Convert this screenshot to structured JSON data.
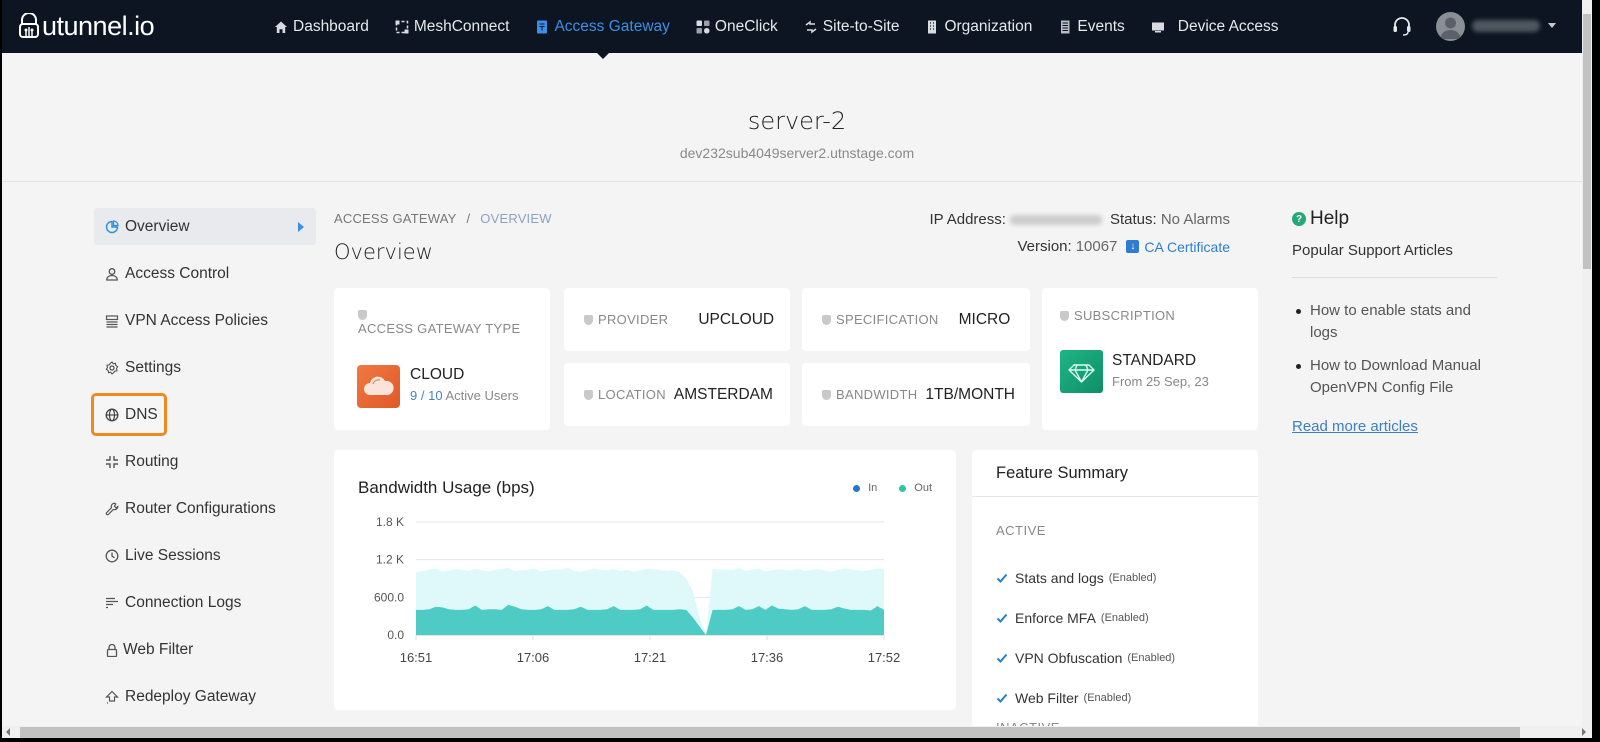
{
  "topnav": {
    "logo": "utunnel.io",
    "items": [
      {
        "label": "Dashboard",
        "icon": "home-icon"
      },
      {
        "label": "MeshConnect",
        "icon": "mesh-icon"
      },
      {
        "label": "Access Gateway",
        "icon": "gateway-icon",
        "active": true
      },
      {
        "label": "OneClick",
        "icon": "apps-icon"
      },
      {
        "label": "Site-to-Site",
        "icon": "arrows-icon"
      },
      {
        "label": "Organization",
        "icon": "building-icon"
      },
      {
        "label": "Events",
        "icon": "events-icon"
      },
      {
        "label": "Device Access",
        "icon": "monitor-icon"
      }
    ]
  },
  "server": {
    "name": "server-2",
    "host": "dev232sub4049server2.utnstage.com"
  },
  "sidebar": {
    "items": [
      {
        "label": "Overview",
        "icon": "pie-icon",
        "active": true
      },
      {
        "label": "Access Control",
        "icon": "user-icon"
      },
      {
        "label": "VPN Access Policies",
        "icon": "list-icon"
      },
      {
        "label": "Settings",
        "icon": "gear-icon"
      },
      {
        "label": "DNS",
        "icon": "globe-icon",
        "highlighted": true
      },
      {
        "label": "Routing",
        "icon": "routing-icon"
      },
      {
        "label": "Router Configurations",
        "icon": "wrench-icon"
      },
      {
        "label": "Live Sessions",
        "icon": "clock-icon"
      },
      {
        "label": "Connection Logs",
        "icon": "lines-icon"
      },
      {
        "label": "Web Filter",
        "icon": "lock-icon"
      },
      {
        "label": "Redeploy Gateway",
        "icon": "redeploy-icon"
      }
    ]
  },
  "breadcrumb": {
    "parent": "ACCESS GATEWAY",
    "sep": "/",
    "current": "OVERVIEW"
  },
  "page_title": "Overview",
  "meta": {
    "ip_label": "IP Address:",
    "status_label": "Status:",
    "status_value": "No Alarms",
    "version_label": "Version:",
    "version_value": "10067",
    "ca_label": "CA Certificate"
  },
  "cards": {
    "type": {
      "label": "ACCESS GATEWAY TYPE",
      "value": "CLOUD",
      "active_users": "9",
      "sep": "/",
      "total_users": "10",
      "users_suffix": "Active Users"
    },
    "provider": {
      "label": "PROVIDER",
      "value": "UPCLOUD"
    },
    "location": {
      "label": "LOCATION",
      "value": "AMSTERDAM"
    },
    "specification": {
      "label": "SPECIFICATION",
      "value": "MICRO"
    },
    "bandwidth": {
      "label": "BANDWIDTH",
      "value": "1TB/MONTH"
    },
    "subscription": {
      "label": "SUBSCRIPTION",
      "value": "STANDARD",
      "since": "From 25 Sep, 23"
    }
  },
  "chart_data": {
    "type": "area",
    "title": "Bandwidth Usage (bps)",
    "xlabel": "",
    "ylabel": "",
    "ylim": [
      0,
      1800
    ],
    "yticks": [
      "0.0",
      "600.0",
      "1.2 K",
      "1.8 K"
    ],
    "ytick_values": [
      0,
      600,
      1200,
      1800
    ],
    "xticks": [
      "16:51",
      "17:06",
      "17:21",
      "17:36",
      "17:52"
    ],
    "legend_position": "top-right",
    "grid": true,
    "colors": {
      "In": "#1f7bc4",
      "Out": "#2ec6a0",
      "in_fill": "#dff9fb",
      "out_fill": "#4ecbc4"
    },
    "series": [
      {
        "name": "In",
        "values": [
          1000,
          1020,
          1040,
          1060,
          1010,
          1030,
          1050,
          1040,
          1020,
          1060,
          1030,
          1010,
          1040,
          1050,
          1070,
          1020,
          1030,
          1040,
          1060,
          1010,
          1030,
          1050,
          1040,
          1070,
          1020,
          1010,
          1030,
          1060,
          1040,
          1030,
          1050,
          1020,
          1040,
          1010,
          1030,
          1060,
          1050,
          1040,
          1020,
          1030,
          1000,
          900,
          700,
          300,
          0,
          1060,
          1040,
          1050,
          1030,
          1070,
          1020,
          1040,
          1060,
          1010,
          1030,
          1050,
          1040,
          1030,
          1060,
          1020,
          1040,
          1050,
          1030,
          1010,
          1040,
          1060,
          1050,
          1030,
          1020,
          1040,
          1060,
          1050
        ]
      },
      {
        "name": "Out",
        "values": [
          400,
          400,
          410,
          450,
          440,
          410,
          400,
          400,
          410,
          470,
          400,
          410,
          410,
          400,
          480,
          450,
          410,
          400,
          400,
          410,
          460,
          400,
          400,
          400,
          410,
          450,
          400,
          400,
          400,
          410,
          460,
          400,
          400,
          400,
          410,
          470,
          400,
          400,
          400,
          400,
          410,
          400,
          280,
          140,
          0,
          400,
          400,
          400,
          410,
          460,
          400,
          410,
          460,
          400,
          470,
          420,
          410,
          400,
          410,
          460,
          400,
          400,
          400,
          410,
          450,
          420,
          400,
          400,
          400,
          390,
          460,
          400
        ]
      }
    ]
  },
  "features": {
    "title": "Feature Summary",
    "active_label": "ACTIVE",
    "active": [
      {
        "name": "Stats and logs",
        "status": "(Enabled)"
      },
      {
        "name": "Enforce MFA",
        "status": "(Enabled)"
      },
      {
        "name": "VPN Obfuscation",
        "status": "(Enabled)"
      },
      {
        "name": "Web Filter",
        "status": "(Enabled)"
      }
    ],
    "inactive_label": "INACTIVE"
  },
  "help": {
    "title": "Help",
    "subtitle": "Popular Support Articles",
    "articles": [
      "How to enable stats and logs",
      "How to Download Manual OpenVPN Config File"
    ],
    "read_more": "Read more articles"
  }
}
